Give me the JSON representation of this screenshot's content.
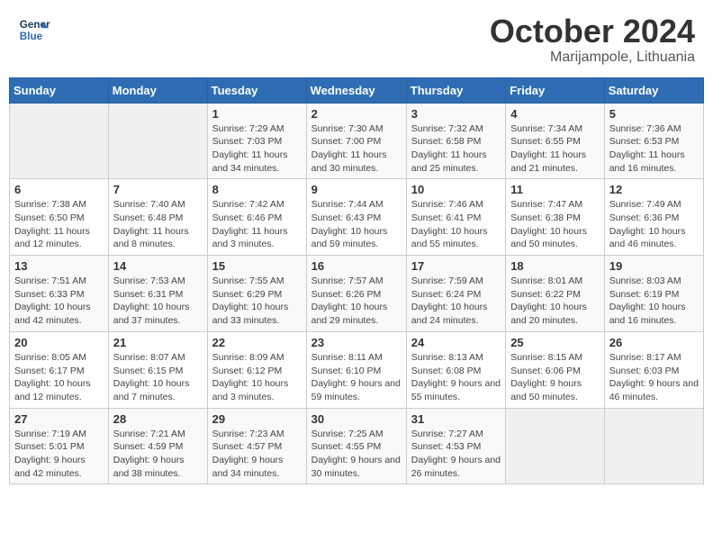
{
  "header": {
    "logo_general": "General",
    "logo_blue": "Blue",
    "month_year": "October 2024",
    "location": "Marijampole, Lithuania"
  },
  "weekdays": [
    "Sunday",
    "Monday",
    "Tuesday",
    "Wednesday",
    "Thursday",
    "Friday",
    "Saturday"
  ],
  "weeks": [
    [
      {
        "day": "",
        "info": ""
      },
      {
        "day": "",
        "info": ""
      },
      {
        "day": "1",
        "info": "Sunrise: 7:29 AM\nSunset: 7:03 PM\nDaylight: 11 hours and 34 minutes."
      },
      {
        "day": "2",
        "info": "Sunrise: 7:30 AM\nSunset: 7:00 PM\nDaylight: 11 hours and 30 minutes."
      },
      {
        "day": "3",
        "info": "Sunrise: 7:32 AM\nSunset: 6:58 PM\nDaylight: 11 hours and 25 minutes."
      },
      {
        "day": "4",
        "info": "Sunrise: 7:34 AM\nSunset: 6:55 PM\nDaylight: 11 hours and 21 minutes."
      },
      {
        "day": "5",
        "info": "Sunrise: 7:36 AM\nSunset: 6:53 PM\nDaylight: 11 hours and 16 minutes."
      }
    ],
    [
      {
        "day": "6",
        "info": "Sunrise: 7:38 AM\nSunset: 6:50 PM\nDaylight: 11 hours and 12 minutes."
      },
      {
        "day": "7",
        "info": "Sunrise: 7:40 AM\nSunset: 6:48 PM\nDaylight: 11 hours and 8 minutes."
      },
      {
        "day": "8",
        "info": "Sunrise: 7:42 AM\nSunset: 6:46 PM\nDaylight: 11 hours and 3 minutes."
      },
      {
        "day": "9",
        "info": "Sunrise: 7:44 AM\nSunset: 6:43 PM\nDaylight: 10 hours and 59 minutes."
      },
      {
        "day": "10",
        "info": "Sunrise: 7:46 AM\nSunset: 6:41 PM\nDaylight: 10 hours and 55 minutes."
      },
      {
        "day": "11",
        "info": "Sunrise: 7:47 AM\nSunset: 6:38 PM\nDaylight: 10 hours and 50 minutes."
      },
      {
        "day": "12",
        "info": "Sunrise: 7:49 AM\nSunset: 6:36 PM\nDaylight: 10 hours and 46 minutes."
      }
    ],
    [
      {
        "day": "13",
        "info": "Sunrise: 7:51 AM\nSunset: 6:33 PM\nDaylight: 10 hours and 42 minutes."
      },
      {
        "day": "14",
        "info": "Sunrise: 7:53 AM\nSunset: 6:31 PM\nDaylight: 10 hours and 37 minutes."
      },
      {
        "day": "15",
        "info": "Sunrise: 7:55 AM\nSunset: 6:29 PM\nDaylight: 10 hours and 33 minutes."
      },
      {
        "day": "16",
        "info": "Sunrise: 7:57 AM\nSunset: 6:26 PM\nDaylight: 10 hours and 29 minutes."
      },
      {
        "day": "17",
        "info": "Sunrise: 7:59 AM\nSunset: 6:24 PM\nDaylight: 10 hours and 24 minutes."
      },
      {
        "day": "18",
        "info": "Sunrise: 8:01 AM\nSunset: 6:22 PM\nDaylight: 10 hours and 20 minutes."
      },
      {
        "day": "19",
        "info": "Sunrise: 8:03 AM\nSunset: 6:19 PM\nDaylight: 10 hours and 16 minutes."
      }
    ],
    [
      {
        "day": "20",
        "info": "Sunrise: 8:05 AM\nSunset: 6:17 PM\nDaylight: 10 hours and 12 minutes."
      },
      {
        "day": "21",
        "info": "Sunrise: 8:07 AM\nSunset: 6:15 PM\nDaylight: 10 hours and 7 minutes."
      },
      {
        "day": "22",
        "info": "Sunrise: 8:09 AM\nSunset: 6:12 PM\nDaylight: 10 hours and 3 minutes."
      },
      {
        "day": "23",
        "info": "Sunrise: 8:11 AM\nSunset: 6:10 PM\nDaylight: 9 hours and 59 minutes."
      },
      {
        "day": "24",
        "info": "Sunrise: 8:13 AM\nSunset: 6:08 PM\nDaylight: 9 hours and 55 minutes."
      },
      {
        "day": "25",
        "info": "Sunrise: 8:15 AM\nSunset: 6:06 PM\nDaylight: 9 hours and 50 minutes."
      },
      {
        "day": "26",
        "info": "Sunrise: 8:17 AM\nSunset: 6:03 PM\nDaylight: 9 hours and 46 minutes."
      }
    ],
    [
      {
        "day": "27",
        "info": "Sunrise: 7:19 AM\nSunset: 5:01 PM\nDaylight: 9 hours and 42 minutes."
      },
      {
        "day": "28",
        "info": "Sunrise: 7:21 AM\nSunset: 4:59 PM\nDaylight: 9 hours and 38 minutes."
      },
      {
        "day": "29",
        "info": "Sunrise: 7:23 AM\nSunset: 4:57 PM\nDaylight: 9 hours and 34 minutes."
      },
      {
        "day": "30",
        "info": "Sunrise: 7:25 AM\nSunset: 4:55 PM\nDaylight: 9 hours and 30 minutes."
      },
      {
        "day": "31",
        "info": "Sunrise: 7:27 AM\nSunset: 4:53 PM\nDaylight: 9 hours and 26 minutes."
      },
      {
        "day": "",
        "info": ""
      },
      {
        "day": "",
        "info": ""
      }
    ]
  ]
}
